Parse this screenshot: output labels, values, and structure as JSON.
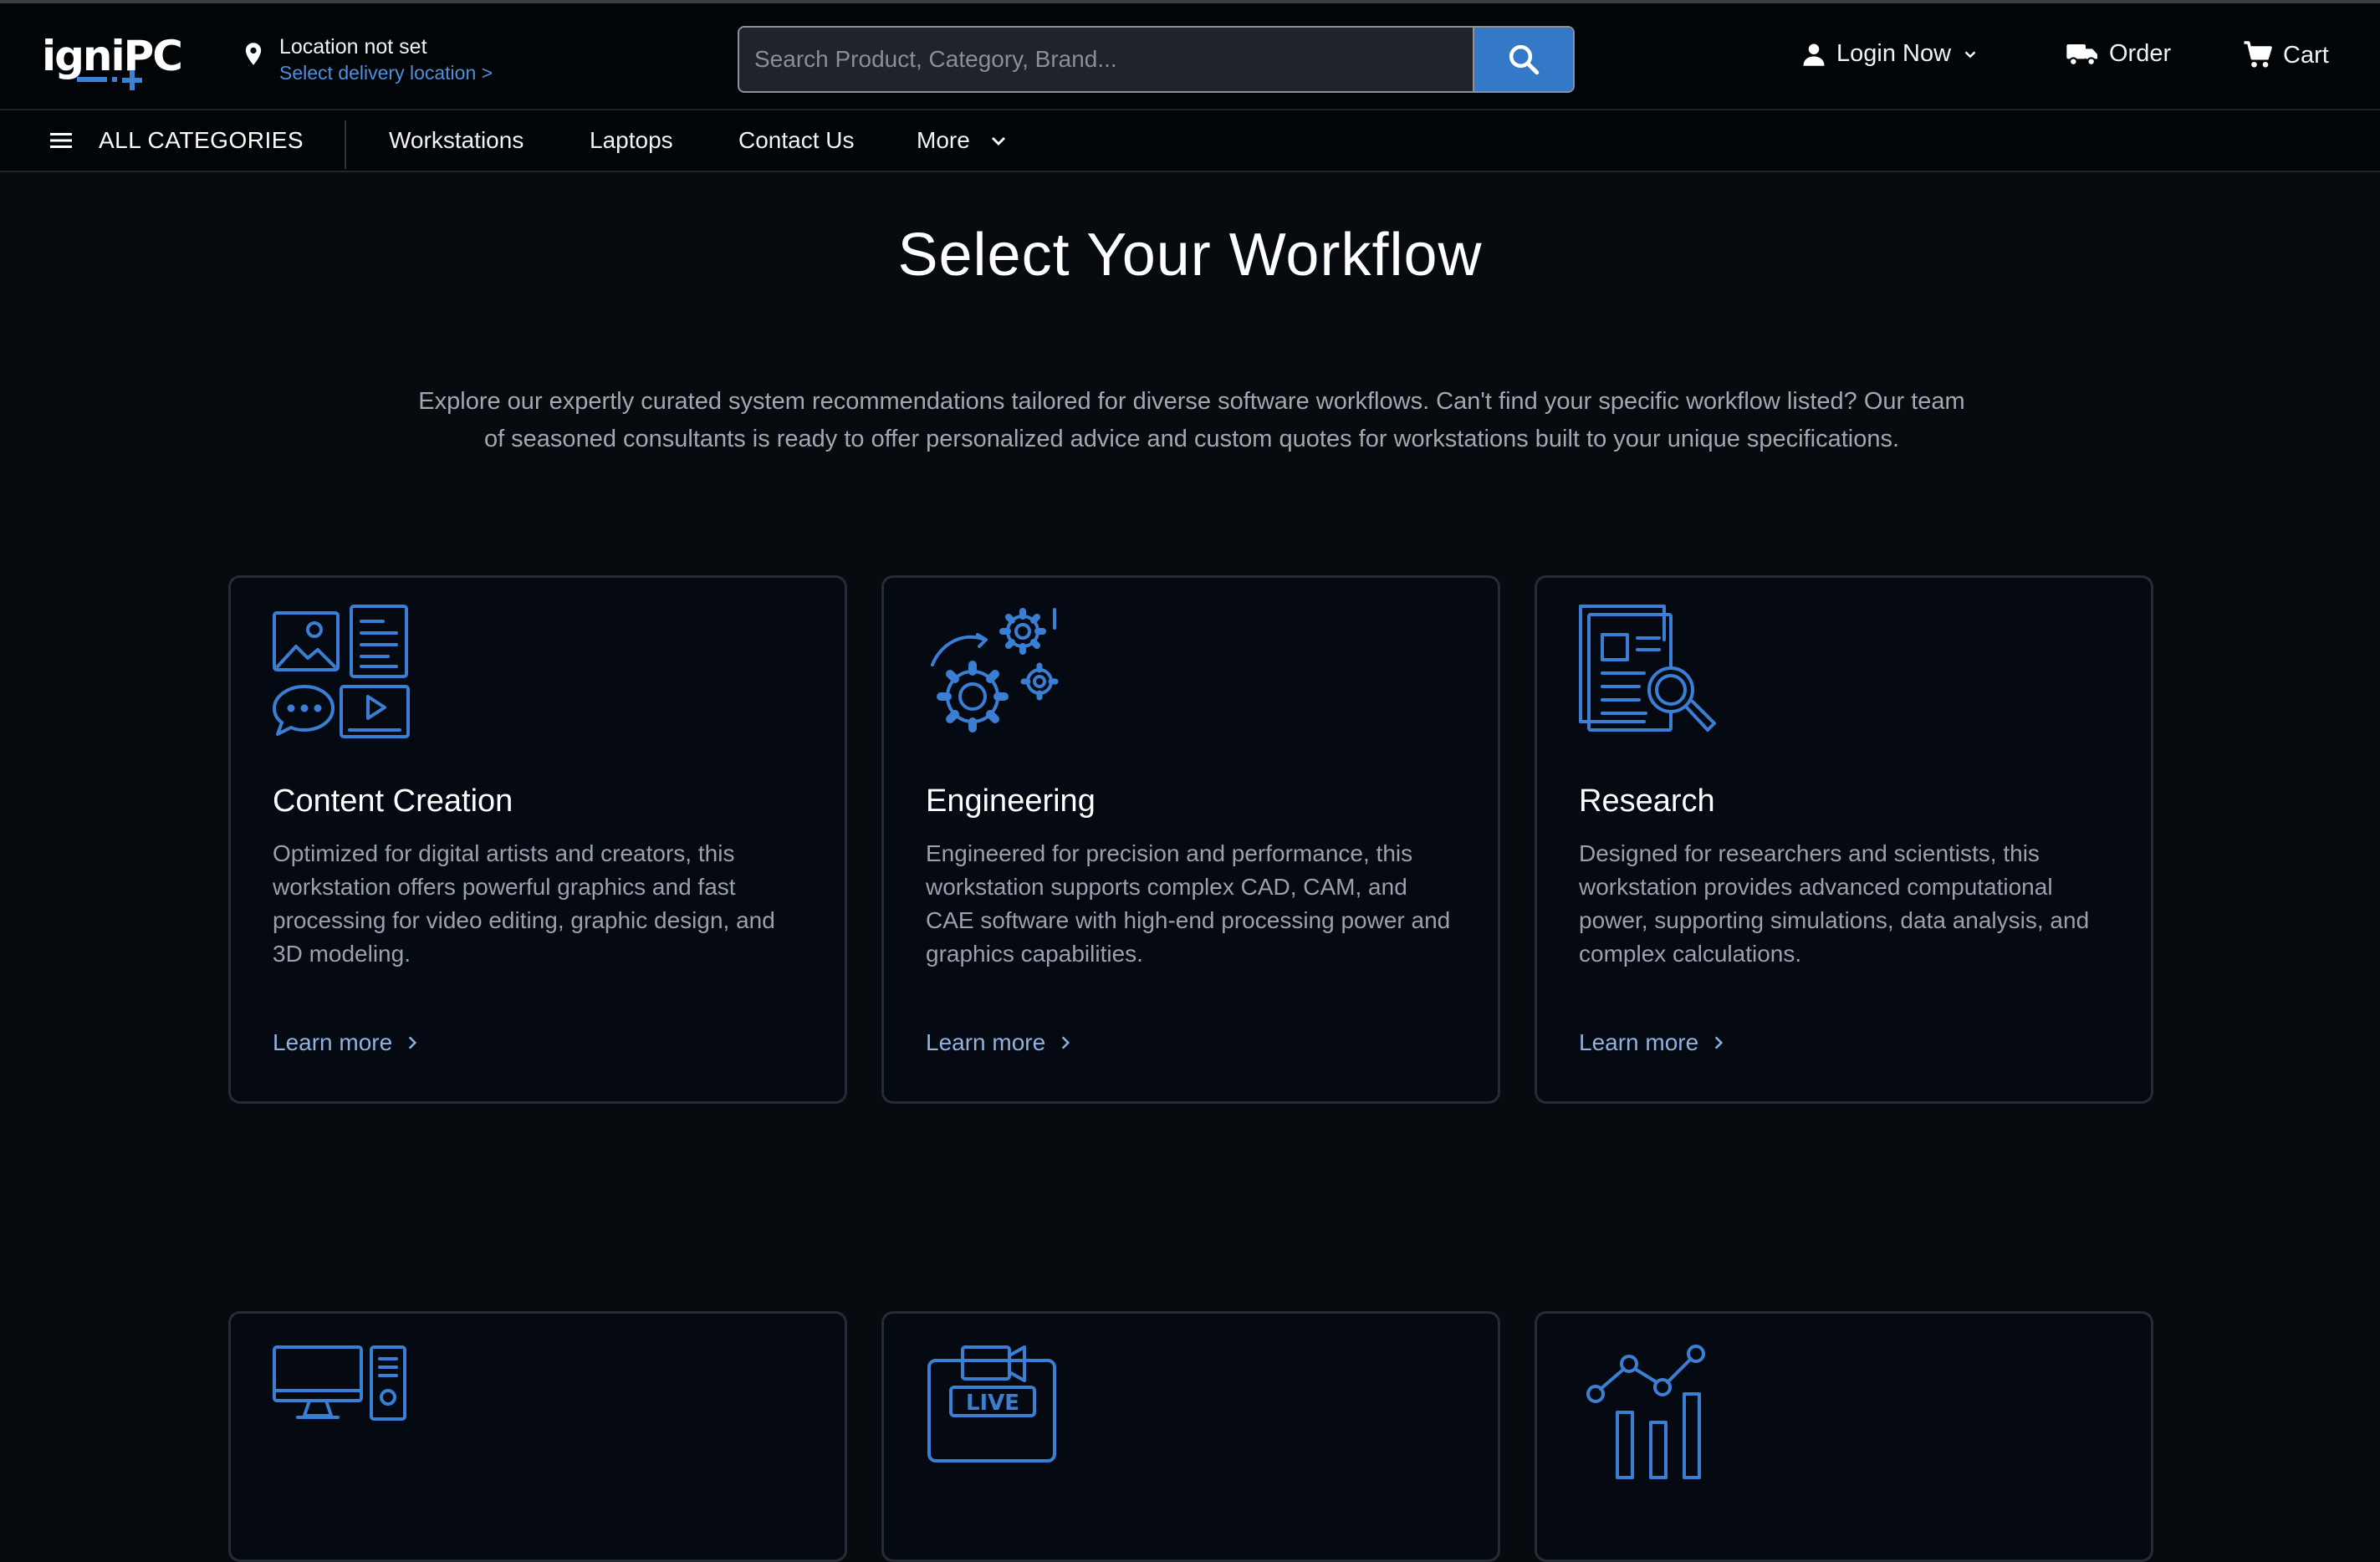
{
  "header": {
    "logo_text": "igniPC",
    "location_title": "Location not set",
    "location_link": "Select delivery location >",
    "search_placeholder": "Search Product, Category, Brand...",
    "login_label": "Login Now",
    "order_label": "Order",
    "cart_label": "Cart"
  },
  "nav": {
    "all_categories": "ALL CATEGORIES",
    "links": [
      "Workstations",
      "Laptops",
      "Contact Us",
      "More"
    ]
  },
  "main": {
    "title": "Select Your Workflow",
    "intro": "Explore our expertly curated system recommendations tailored for diverse software workflows. Can't find your specific workflow listed? Our team of seasoned consultants is ready to offer personalized advice and custom quotes for workstations built to your unique specifications.",
    "cards": [
      {
        "title": "Content Creation",
        "description": "Optimized for digital artists and creators, this workstation offers powerful graphics and fast processing for video editing, graphic design, and 3D modeling.",
        "link": "Learn more",
        "icon": "media-collage-icon"
      },
      {
        "title": "Engineering",
        "description": "Engineered for precision and performance, this workstation supports complex CAD, CAM, and CAE software with high-end processing power and graphics capabilities.",
        "link": "Learn more",
        "icon": "gears-icon"
      },
      {
        "title": "Research",
        "description": "Designed for researchers and scientists, this workstation provides advanced computational power, supporting simulations, data analysis, and complex calculations.",
        "link": "Learn more",
        "icon": "document-search-icon"
      },
      {
        "icon": "desktop-computer-icon"
      },
      {
        "icon": "live-stream-icon",
        "badge": "LIVE"
      },
      {
        "icon": "analytics-chart-icon"
      }
    ]
  },
  "colors": {
    "accent": "#3478c8",
    "icon_blue": "#3b7fd4",
    "link_blue": "#4f8fde",
    "background": "#070a0f",
    "card_bg": "#040912"
  }
}
